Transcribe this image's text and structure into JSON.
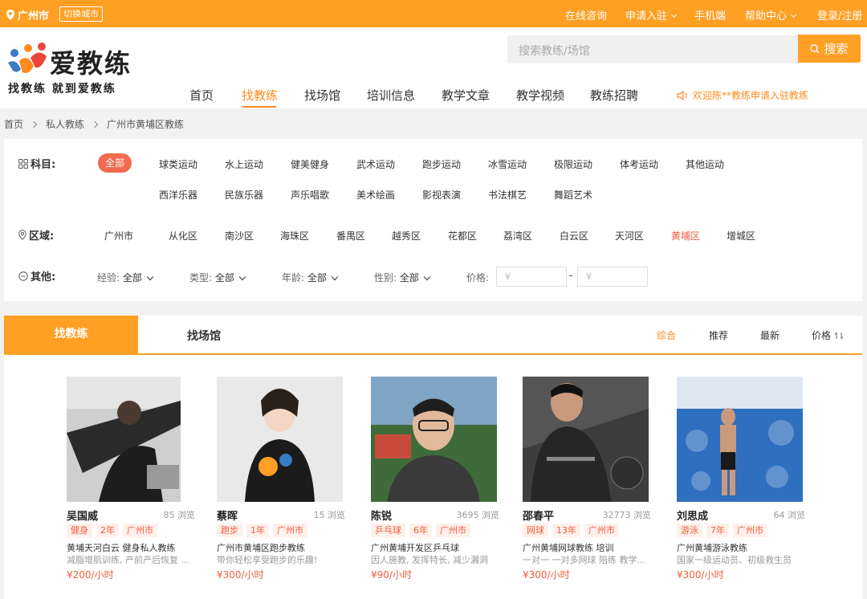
{
  "topbar": {
    "city": "广州市",
    "switch_city": "切换城市",
    "online_consult": "在线咨询",
    "apply_join": "申请入驻",
    "mobile": "手机端",
    "help_center": "帮助中心",
    "login": "登录/注册",
    "accent_color": "#ff9f24"
  },
  "header": {
    "logo_text": "爱教练",
    "slogan": "找教练 就到爱教练",
    "search_placeholder": "搜索教练/场馆",
    "search_button": "搜索",
    "nav": [
      "首页",
      "找教练",
      "找场馆",
      "培训信息",
      "教学文章",
      "教学视频",
      "教练招聘"
    ],
    "active_nav": "找教练",
    "welcome": "欢迎陈**教练申请入驻教练"
  },
  "breadcrumb": [
    "首页",
    "私人教练",
    "广州市黄埔区教练"
  ],
  "filters": {
    "subject_label": "科目:",
    "subject_all": "全部",
    "subjects_row1": [
      "球类运动",
      "水上运动",
      "健美健身",
      "武术运动",
      "跑步运动",
      "冰雪运动",
      "极限运动",
      "体考运动",
      "其他运动"
    ],
    "subjects_row2": [
      "西洋乐器",
      "民族乐器",
      "声乐唱歌",
      "美术绘画",
      "影视表演",
      "书法棋艺",
      "舞蹈艺术"
    ],
    "area_label": "区域:",
    "areas": [
      "广州市",
      "从化区",
      "南沙区",
      "海珠区",
      "番禺区",
      "越秀区",
      "花都区",
      "荔湾区",
      "白云区",
      "天河区",
      "黄埔区",
      "增城区"
    ],
    "active_area": "黄埔区",
    "other_label": "其他:",
    "dropdowns": [
      {
        "label": "经验:",
        "value": "全部"
      },
      {
        "label": "类型:",
        "value": "全部"
      },
      {
        "label": "年龄:",
        "value": "全部"
      },
      {
        "label": "性别:",
        "value": "全部"
      }
    ],
    "price_label": "价格:",
    "price_min_placeholder": "¥",
    "price_max_placeholder": "¥",
    "price_sep": "-"
  },
  "results": {
    "tab_active": "找教练",
    "tab_other": "找场馆",
    "sorts": [
      "综合",
      "推荐",
      "最新",
      "价格"
    ],
    "active_sort": "综合",
    "coaches": [
      {
        "name": "吴国威",
        "views": "85 浏览",
        "tags": [
          "健身",
          "2年",
          "广州市"
        ],
        "title": "黄埔天河白云 健身私人教练",
        "desc": "减脂增肌训练, 产前产后恢复 ...",
        "price": "¥200/小时"
      },
      {
        "name": "蔡晖",
        "views": "15 浏览",
        "tags": [
          "跑步",
          "1年",
          "广州市"
        ],
        "title": "广州市黄埔区跑步教练",
        "desc": "带你轻松享受跑步的乐趣!",
        "price": "¥300/小时"
      },
      {
        "name": "陈锐",
        "views": "3695 浏览",
        "tags": [
          "乒乓球",
          "6年",
          "广州市"
        ],
        "title": "广州黄埔开发区乒乓球",
        "desc": "因人施教, 发挥特长, 减少漏洞",
        "price": "¥90/小时"
      },
      {
        "name": "邵春平",
        "views": "32773 浏览",
        "tags": [
          "网球",
          "13年",
          "广州市"
        ],
        "title": "广州黄埔网球教练 培训",
        "desc": "一对一 一对多网球 陪练 教学...",
        "price": "¥300/小时"
      },
      {
        "name": "刘思成",
        "views": "64 浏览",
        "tags": [
          "游泳",
          "7年",
          "广州市"
        ],
        "title": "广州黄埔游泳教练",
        "desc": "国家一级运动员、初级救生员",
        "price": "¥300/小时"
      }
    ]
  }
}
